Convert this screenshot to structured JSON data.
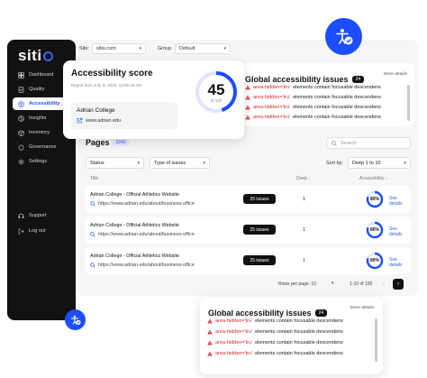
{
  "sidebar": {
    "logo": "siti",
    "items": [
      {
        "label": "Dashboard",
        "icon": "dashboard-icon"
      },
      {
        "label": "Quality",
        "icon": "quality-icon"
      },
      {
        "label": "Accessibility",
        "icon": "accessibility-icon",
        "active": true
      },
      {
        "label": "Insights",
        "icon": "insights-icon"
      },
      {
        "label": "Inventory",
        "icon": "inventory-icon"
      },
      {
        "label": "Governance",
        "icon": "governance-icon"
      },
      {
        "label": "Settings",
        "icon": "settings-icon"
      }
    ],
    "bottom_items": [
      {
        "label": "Support",
        "icon": "support-icon"
      },
      {
        "label": "Log out",
        "icon": "logout-icon"
      }
    ]
  },
  "topbar": {
    "site_label": "Site:",
    "site_value": "sitio.com",
    "group_label": "Group",
    "group_value": "Default"
  },
  "score_card": {
    "title": "Accessibility score",
    "subtitle": "Report from July 11 2023, 12:55:40 AM",
    "score": "45",
    "score_of": "of 100",
    "score_fraction": 0.45,
    "college_name": "Adrian College",
    "college_url": "www.adrian.edu"
  },
  "global_issues": {
    "title": "Global accessibility issues",
    "count": "24",
    "more": "More details",
    "issues": [
      {
        "code": "area-hidden='tru'",
        "text": "elements contain focusable descendens"
      },
      {
        "code": "area-hidden='tru'",
        "text": "elements contain focusable descendens"
      },
      {
        "code": "area-hidden='tru'",
        "text": "elements contain focusable descendens"
      },
      {
        "code": "area-hidden='tru'",
        "text": "elements contain focusable descendens"
      }
    ]
  },
  "pages": {
    "title": "Pages",
    "count": "3242",
    "search_placeholder": "Search",
    "status_filter": "Status",
    "type_filter": "Type of issues",
    "sort_label": "Sort by:",
    "sort_value": "Deep 1 to 10",
    "columns": {
      "title": "Title",
      "depth": "Deep ↓",
      "accessibility": "Accessibility ↓"
    },
    "rows": [
      {
        "title": "Adrian College - Official Athletics Website",
        "url": "https://www.adrian.edu/about/business-office",
        "issues": "25 issues",
        "depth": "1",
        "score": "80%",
        "score_fraction": 0.8,
        "see": "See details"
      },
      {
        "title": "Adrian College - Official Athletics Website",
        "url": "https://www.adrian.edu/about/business-office",
        "issues": "25 issues",
        "depth": "1",
        "score": "80%",
        "score_fraction": 0.8,
        "see": "See details"
      },
      {
        "title": "Adrian College - Official Athletics Website",
        "url": "https://www.adrian.edu/about/business-office",
        "issues": "25 issues",
        "depth": "1",
        "score": "80%",
        "score_fraction": 0.8,
        "see": "See details"
      }
    ],
    "rows_per_page_label": "Rows per page: 10",
    "range": "1-10 of 100"
  },
  "bottom_card": {
    "title": "Global accessibility issues",
    "count": "24",
    "more": "More details",
    "issues": [
      {
        "code": "area-hidden='tru'",
        "text": "elements contain focusable descendens"
      },
      {
        "code": "area-hidden='tru'",
        "text": "elements contain focusable descendens"
      },
      {
        "code": "area-hidden='tru'",
        "text": "elements contain focusable descendens"
      },
      {
        "code": "area-hidden='tru'",
        "text": "elements contain focusable descendens"
      }
    ]
  },
  "colors": {
    "accent": "#1c4dff",
    "sidebar": "#121212",
    "error": "#d8262c",
    "gauge_bg": "#dfe5ff"
  }
}
